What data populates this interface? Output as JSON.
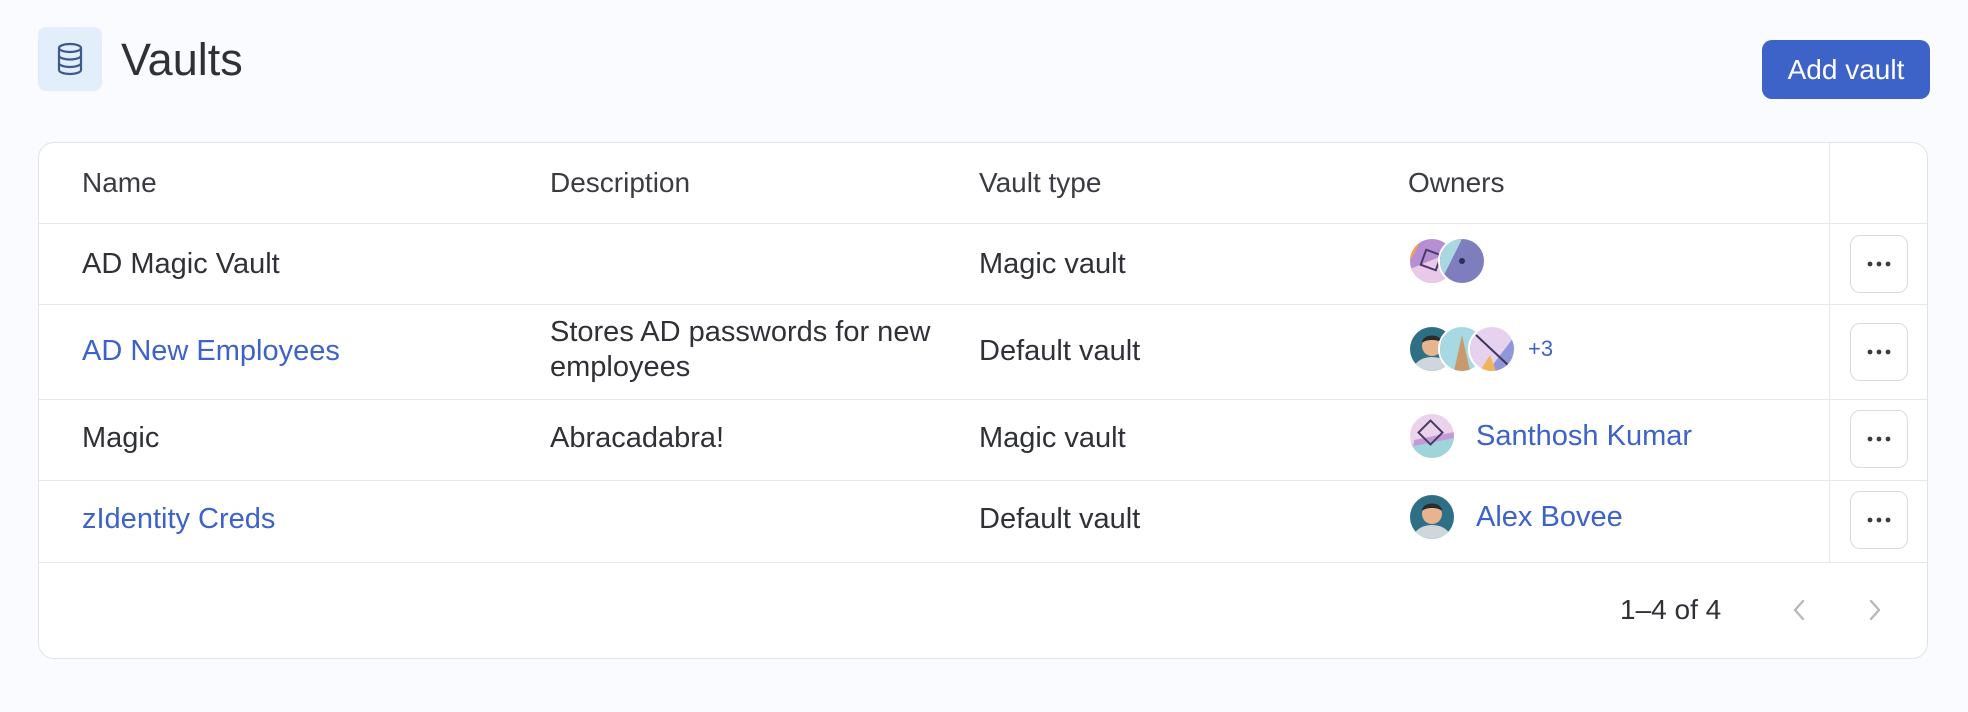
{
  "header": {
    "title": "Vaults",
    "icon": "database-icon",
    "add_label": "Add vault"
  },
  "table": {
    "columns": [
      "Name",
      "Description",
      "Vault type",
      "Owners"
    ],
    "rows": [
      {
        "name": "AD Magic Vault",
        "name_is_link": false,
        "description": "",
        "type": "Magic vault",
        "owners": {
          "avatars": [
            "abstract-avatar",
            "abstract-avatar"
          ],
          "more": "",
          "name": ""
        }
      },
      {
        "name": "AD New Employees",
        "name_is_link": true,
        "description": "Stores AD passwords for new employees",
        "type": "Default vault",
        "owners": {
          "avatars": [
            "photo-avatar",
            "abstract-avatar",
            "abstract-avatar"
          ],
          "more": "+3",
          "name": ""
        }
      },
      {
        "name": "Magic",
        "name_is_link": false,
        "description": "Abracadabra!",
        "type": "Magic vault",
        "owners": {
          "avatars": [
            "abstract-avatar"
          ],
          "more": "",
          "name": "Santhosh Kumar"
        }
      },
      {
        "name": "zIdentity Creds",
        "name_is_link": true,
        "description": "",
        "type": "Default vault",
        "owners": {
          "avatars": [
            "photo-avatar"
          ],
          "more": "",
          "name": "Alex Bovee"
        }
      }
    ],
    "row_actions_icon": "more-horizontal-icon"
  },
  "pagination": {
    "range_label": "1–4 of 4",
    "prev_icon": "chevron-left-icon",
    "next_icon": "chevron-right-icon"
  },
  "colors": {
    "accent": "#3d63c8",
    "background": "#fafbfe",
    "border": "#e1e3e8"
  }
}
